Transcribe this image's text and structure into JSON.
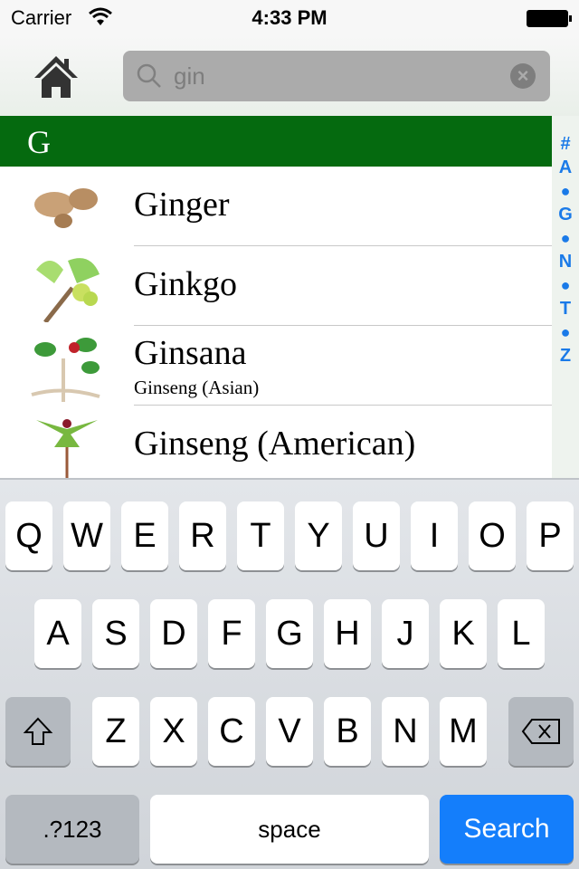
{
  "status": {
    "carrier": "Carrier",
    "time": "4:33 PM"
  },
  "nav": {
    "home_icon": "home-icon",
    "search_value": "gin",
    "search_icon": "search-icon",
    "clear_icon": "clear-icon"
  },
  "section": {
    "letter": "G",
    "color": "#056a0f"
  },
  "index": [
    "#",
    "A",
    "●",
    "G",
    "●",
    "N",
    "●",
    "T",
    "●",
    "Z"
  ],
  "items": [
    {
      "title": "Ginger",
      "subtitle": ""
    },
    {
      "title": "Ginkgo",
      "subtitle": ""
    },
    {
      "title": "Ginsana",
      "subtitle": "Ginseng (Asian)"
    },
    {
      "title": "Ginseng (American)",
      "subtitle": ""
    }
  ],
  "keyboard": {
    "row1": [
      "Q",
      "W",
      "E",
      "R",
      "T",
      "Y",
      "U",
      "I",
      "O",
      "P"
    ],
    "row2": [
      "A",
      "S",
      "D",
      "F",
      "G",
      "H",
      "J",
      "K",
      "L"
    ],
    "row3": [
      "Z",
      "X",
      "C",
      "V",
      "B",
      "N",
      "M"
    ],
    "numbers": ".?123",
    "space": "space",
    "search": "Search",
    "accent": "#147efb"
  }
}
